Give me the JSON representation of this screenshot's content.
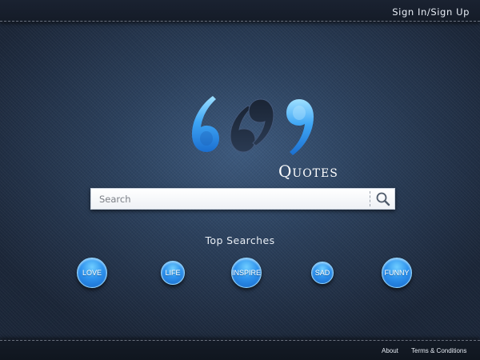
{
  "header": {
    "signin_label": "Sign In/Sign Up"
  },
  "logo": {
    "word": "Quotes"
  },
  "search": {
    "placeholder": "Search"
  },
  "top_searches": {
    "title": "Top Searches",
    "tags": [
      "LOVE",
      "LIFE",
      "INSPIRE",
      "SAD",
      "FUNNY"
    ]
  },
  "footer": {
    "about_label": "About",
    "terms_label": "Terms & Conditions"
  },
  "colors": {
    "accent_blue": "#2e93ee",
    "background": "#2b405c",
    "bar": "#141b27"
  },
  "icons": {
    "search_button": "search-icon"
  }
}
